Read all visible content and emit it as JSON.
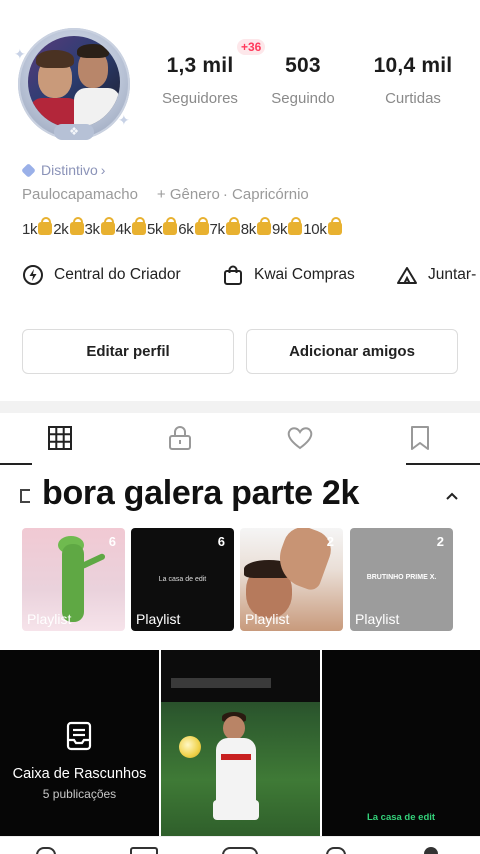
{
  "profile": {
    "avatar_icon": "profile-avatar",
    "stats": {
      "followers_value": "1,3 mil",
      "followers_label": "Seguidores",
      "following_value": "503",
      "following_label": "Seguindo",
      "likes_value": "10,4 mil",
      "likes_label": "Curtidas",
      "new_followers_badge": "+36"
    },
    "badge_label": "Distintivo",
    "badge_chevron": "›",
    "info": {
      "username": "Paulocapamacho",
      "gender": "+ Gênero",
      "sign": "· Capricórnio"
    },
    "levels": [
      "1k",
      "2k",
      "3k",
      "4k",
      "5k",
      "6k",
      "7k",
      "8k",
      "9k",
      "10k"
    ],
    "quick_links": {
      "creator": "Central do Criador",
      "shop": "Kwai Compras",
      "join": "Juntar-"
    },
    "buttons": {
      "edit": "Editar perfil",
      "add_friends": "Adicionar amigos"
    }
  },
  "tabs": [
    {
      "icon": "grid-icon"
    },
    {
      "icon": "lock-icon"
    },
    {
      "icon": "heart-icon"
    },
    {
      "icon": "bookmark-icon"
    }
  ],
  "playlist": {
    "title": "bora galera parte 2k",
    "collapse_icon": "chevron-up-icon",
    "cards": [
      {
        "count": "6",
        "label": "Playlist"
      },
      {
        "count": "6",
        "label": "Playlist",
        "overlay_text": "La casa de edit"
      },
      {
        "count": "2",
        "label": "Playlist"
      },
      {
        "count": "2",
        "label": "Playlist",
        "overlay_text": "BRUTINHO PRIME X."
      }
    ]
  },
  "grid": {
    "drafts_title": "Caixa de Rascunhos",
    "drafts_count": "5 publicações",
    "edit_caption": "La casa de edit"
  },
  "colors": {
    "accent_red": "#ff3b5c",
    "badge_blue": "#8b93b8",
    "lock_gold": "#e8b130",
    "edit_green": "#34d17a"
  }
}
